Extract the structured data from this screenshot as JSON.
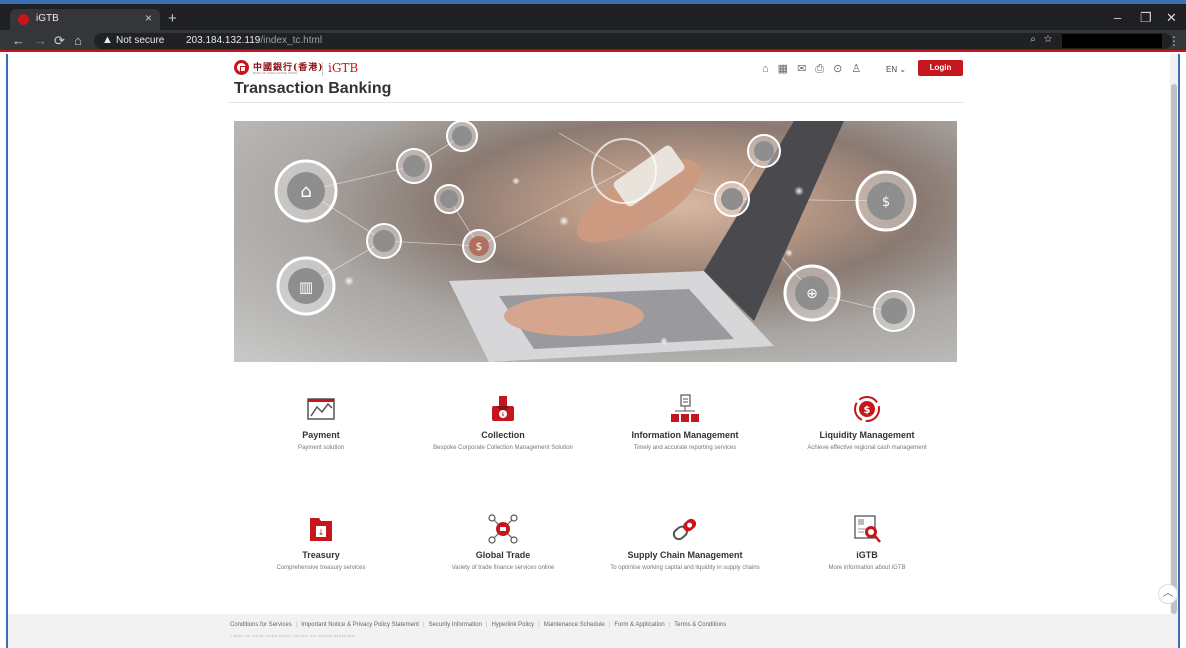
{
  "browser": {
    "tab_title": "iGTB",
    "tab_close": "×",
    "new_tab": "+",
    "not_secure": "Not secure",
    "url_host": "203.184.132.119",
    "url_path": "/index_tc.html",
    "minimize": "–",
    "restore": "❐",
    "close": "✕"
  },
  "header": {
    "logo_cn": "中國銀行(香港)",
    "logo_en": "BANK OF CHINA (HONG KONG)",
    "brand": "iGTB",
    "language": "EN",
    "login_label": "Login"
  },
  "page_title": "Transaction Banking",
  "services_row1": [
    {
      "name": "Payment",
      "desc": "Payment solution",
      "icon": "chart-payment-icon"
    },
    {
      "name": "Collection",
      "desc": "Bespoke Corporate Collection Management Solution",
      "icon": "collection-icon"
    },
    {
      "name": "Information Management",
      "desc": "Timely and accurate reporting services",
      "icon": "information-icon"
    },
    {
      "name": "Liquidity Management",
      "desc": "Achieve effective regional cash management",
      "icon": "liquidity-icon"
    }
  ],
  "services_row2": [
    {
      "name": "Treasury",
      "desc": "Comprehensive treasury services",
      "icon": "treasury-icon"
    },
    {
      "name": "Global Trade",
      "desc": "Variety of trade finance services online",
      "icon": "global-trade-icon"
    },
    {
      "name": "Supply Chain Management",
      "desc": "To optimise working capital and liquidity in supply chains",
      "icon": "supply-chain-icon"
    },
    {
      "name": "iGTB",
      "desc": "More information about iGTB",
      "icon": "igtb-icon"
    }
  ],
  "footer": {
    "links": [
      "Conditions for Services",
      "Important Notice & Privacy Policy Statement",
      "Security Information",
      "Hyperlink Policy",
      "Maintenance Schedule",
      "Form & Application",
      "Terms & Conditions"
    ],
    "copyright": "© BANK OF CHINA (HONG KONG) LIMITED. ALL RIGHTS RESERVED."
  },
  "colors": {
    "brand_red": "#c4161c",
    "chrome_dark": "#202124"
  }
}
